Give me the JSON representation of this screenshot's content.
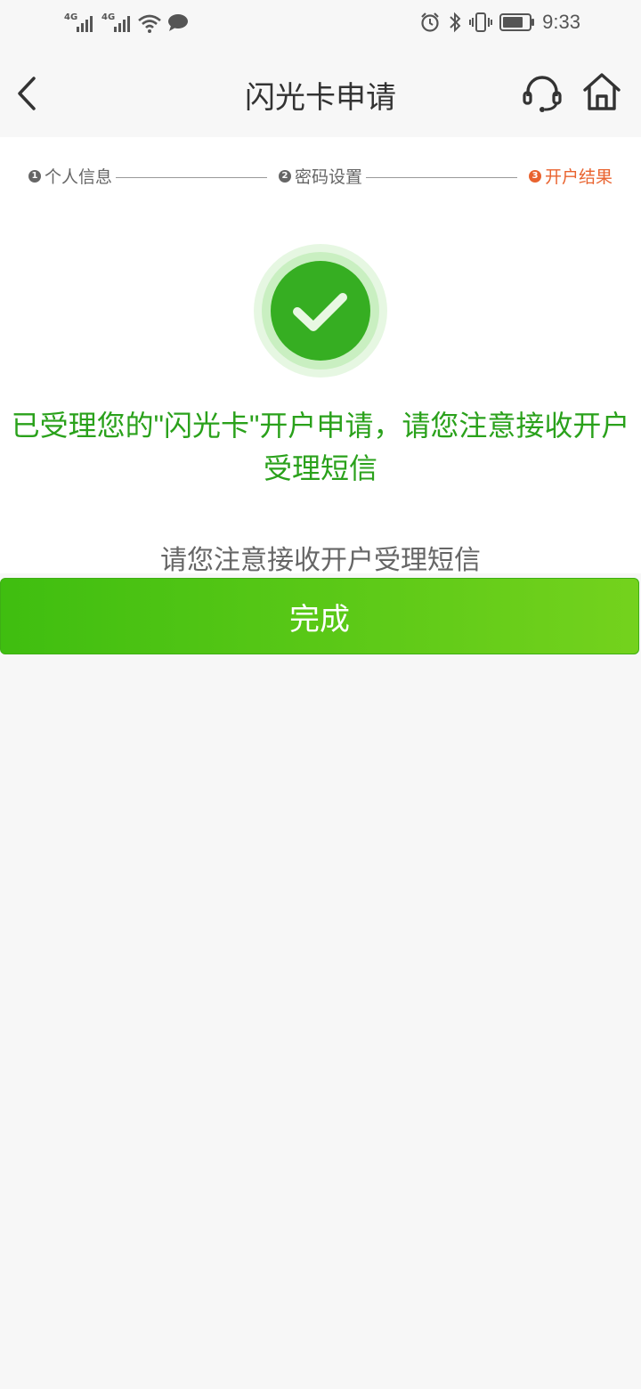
{
  "status_bar": {
    "network1": "4G",
    "network2": "4G",
    "time": "9:33"
  },
  "nav": {
    "title": "闪光卡申请",
    "icons": [
      "back-icon",
      "customer-service-icon",
      "home-icon"
    ]
  },
  "steps": [
    {
      "number": "1",
      "label": "个人信息",
      "state": "done"
    },
    {
      "number": "2",
      "label": "密码设置",
      "state": "done"
    },
    {
      "number": "3",
      "label": "开户结果",
      "state": "active"
    }
  ],
  "result": {
    "message": "已受理您的\"闪光卡\"开户申请，请您注意接收开户受理短信",
    "sub_message": "请您注意接收开户受理短信"
  },
  "actions": {
    "done_label": "完成"
  },
  "colors": {
    "accent_green": "#2aa11b",
    "active_step": "#e9632f",
    "button_start": "#3fbe10",
    "button_end": "#74d21d"
  }
}
